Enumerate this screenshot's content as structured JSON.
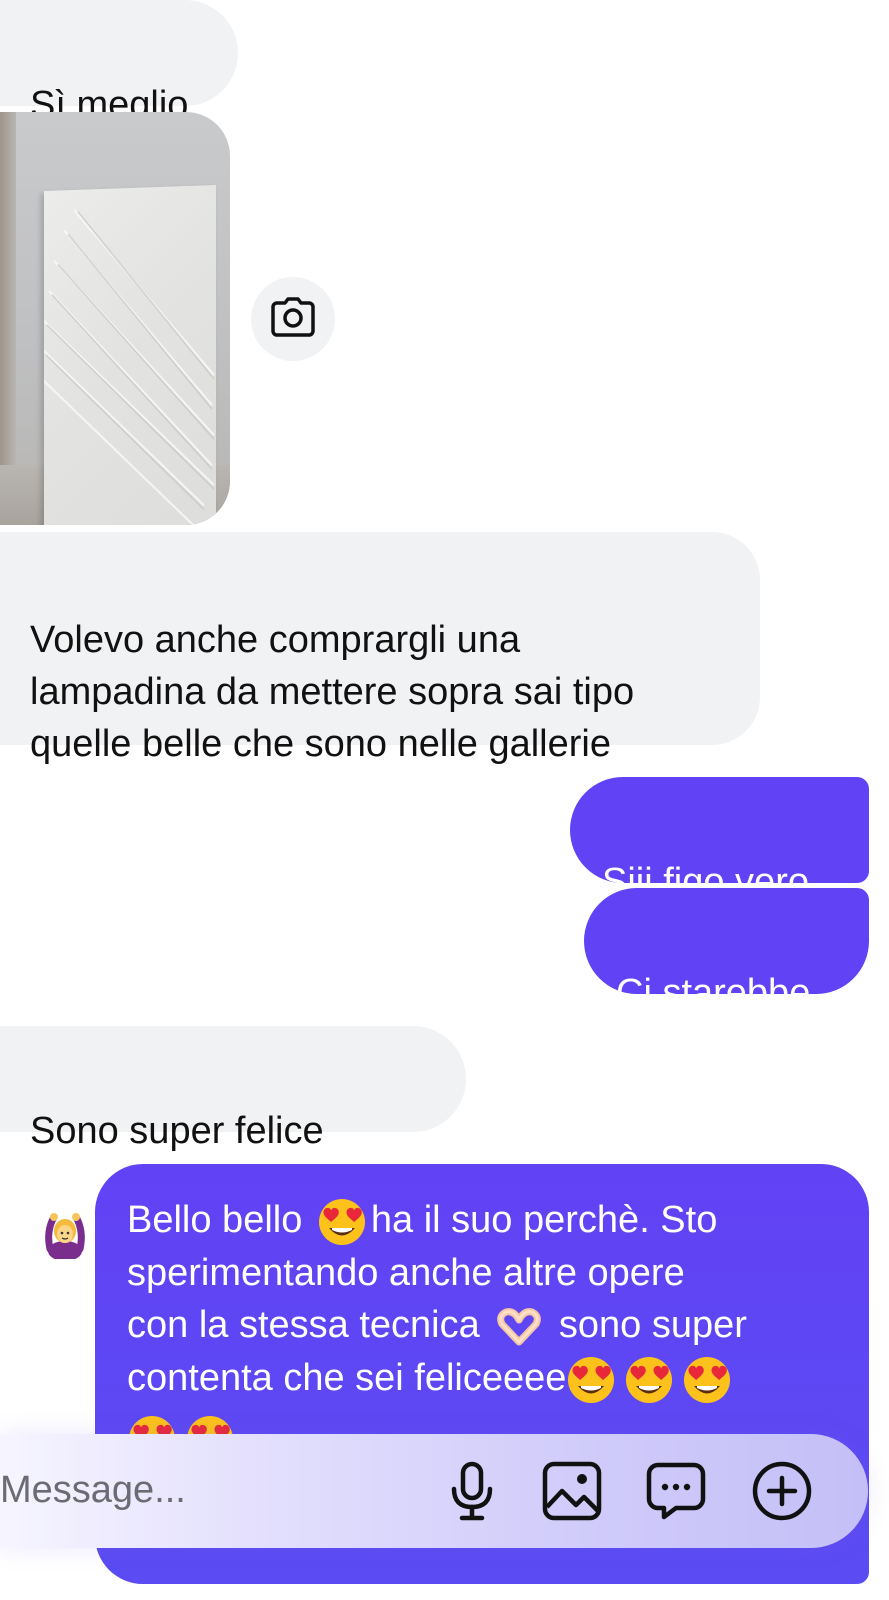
{
  "messages": {
    "m1": "Sì meglio",
    "m3": "Volevo anche comprargli una\nlampadina da mettere sopra sai tipo\nquelle belle che sono nelle gallerie",
    "m4": "Siii figo vero",
    "m5": "Ci starebbe",
    "m6": "Sono super felice",
    "m7": {
      "l1a": "Bello bello",
      "l1b": "ha il suo perchè. Sto",
      "l2": "sperimentando anche altre opere",
      "l3a": "con la stessa tecnica",
      "l3b": "sono super",
      "l4": "contenta che sei feliceeee"
    }
  },
  "composer": {
    "placeholder": "Message..."
  },
  "icons": {
    "camera": "camera-icon",
    "mic": "microphone-icon",
    "gallery": "image-icon",
    "chat": "chat-bubble-icon",
    "plus": "plus-circle-icon",
    "emoji_raise": "person-raising-hands-emoji",
    "emoji_heart_eyes": "heart-eyes-emoji",
    "emoji_heart_hands": "heart-hands-emoji"
  },
  "colors": {
    "outgoing_bubble": "#6242f5",
    "incoming_bubble": "#f1f2f4"
  }
}
